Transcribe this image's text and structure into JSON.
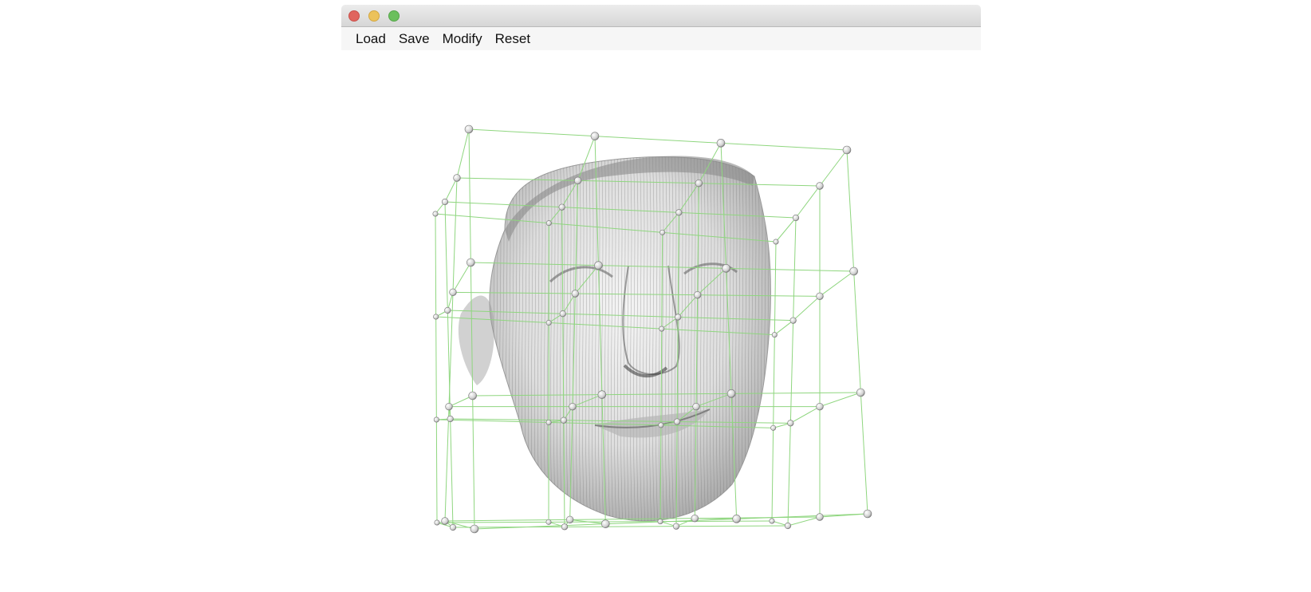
{
  "window": {
    "controls": [
      {
        "name": "close-button",
        "color": "#e0655e"
      },
      {
        "name": "minimize-button",
        "color": "#ecc25b"
      },
      {
        "name": "maximize-button",
        "color": "#6bbf5d"
      }
    ]
  },
  "menu": {
    "items": [
      {
        "label": "Load"
      },
      {
        "label": "Save"
      },
      {
        "label": "Modify"
      },
      {
        "label": "Reset"
      }
    ]
  },
  "viewport": {
    "content": "3D face mesh with free-form deformation control lattice",
    "colors": {
      "lattice": "#8fd67f",
      "mesh": "#d9d9d9",
      "mesh_lines": "#6f6f6f",
      "control_point": "#f2f2f2"
    }
  }
}
